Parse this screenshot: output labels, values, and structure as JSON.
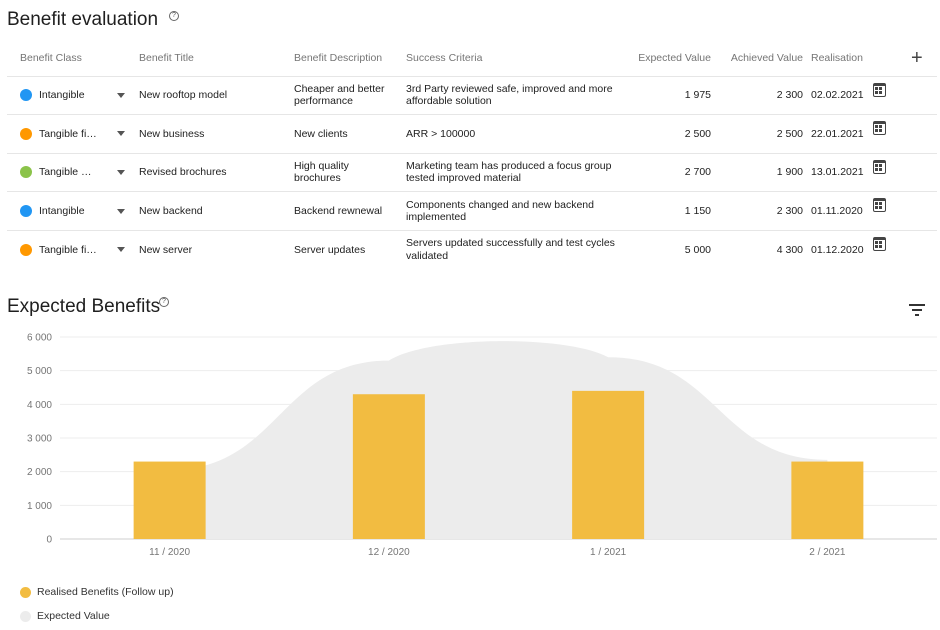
{
  "evaluation": {
    "title": "Benefit evaluation",
    "help_glyph": "?",
    "columns": [
      "Benefit Class",
      "Benefit Title",
      "Benefit Description",
      "Success Criteria",
      "Expected Value",
      "Achieved Value",
      "Realisation"
    ],
    "add_glyph": "+",
    "rows": [
      {
        "class": "Intangible",
        "class_color": "#2196f3",
        "title": "New rooftop model",
        "description": "Cheaper and better performance",
        "criteria": "3rd Party reviewed safe, improved and more affordable solution",
        "expected": "1 975",
        "achieved": "2 300",
        "realisation": "02.02.2021"
      },
      {
        "class": "Tangible fi…",
        "class_color": "#ff9800",
        "title": "New business",
        "description": "New clients",
        "criteria": "ARR > 100000",
        "expected": "2 500",
        "achieved": "2 500",
        "realisation": "22.01.2021"
      },
      {
        "class": "Tangible n…",
        "class_color": "#8bc34a",
        "title": "Revised brochures",
        "description": "High quality brochures",
        "criteria": "Marketing team has produced a focus group tested improved material",
        "expected": "2 700",
        "achieved": "1 900",
        "realisation": "13.01.2021"
      },
      {
        "class": "Intangible",
        "class_color": "#2196f3",
        "title": "New backend",
        "description": "Backend rewnewal",
        "criteria": "Components changed and new backend implemented",
        "expected": "1 150",
        "achieved": "2 300",
        "realisation": "01.11.2020"
      },
      {
        "class": "Tangible fi…",
        "class_color": "#ff9800",
        "title": "New server",
        "description": "Server updates",
        "criteria": "Servers updated successfully and test cycles validated",
        "expected": "5 000",
        "achieved": "4 300",
        "realisation": "01.12.2020"
      }
    ]
  },
  "expected_benefits": {
    "title": "Expected Benefits",
    "help_glyph": "?",
    "legend": [
      "Realised Benefits (Follow up)",
      "Expected Value"
    ]
  },
  "chart_data": {
    "type": "bar",
    "categories": [
      "11 / 2020",
      "12 / 2020",
      "1 / 2021",
      "2 / 2021"
    ],
    "series": [
      {
        "name": "Realised Benefits (Follow up)",
        "type": "bar",
        "values": [
          2300,
          4300,
          4400,
          2300
        ],
        "color": "#f2bc41"
      },
      {
        "name": "Expected Value",
        "type": "area",
        "values": [
          2050,
          5300,
          5400,
          2350
        ],
        "color": "#ececec"
      }
    ],
    "yticks": [
      "0",
      "1 000",
      "2 000",
      "3 000",
      "4 000",
      "5 000",
      "6 000"
    ],
    "ylim": [
      0,
      6000
    ],
    "grid": true,
    "legend_position": "bottom-left"
  }
}
